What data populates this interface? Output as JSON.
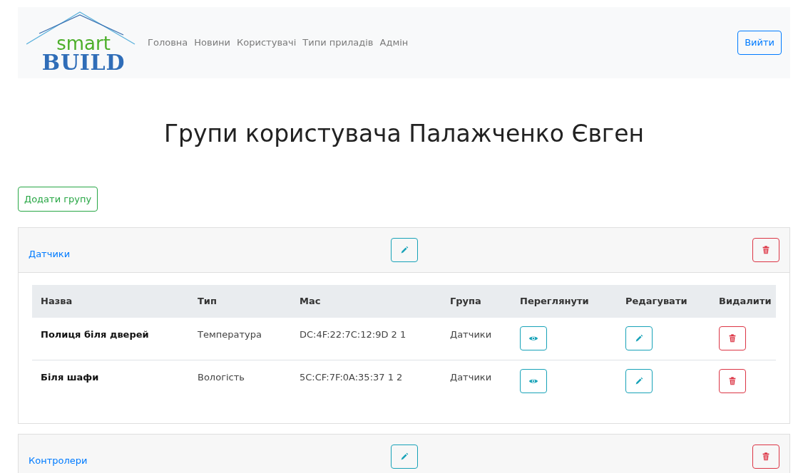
{
  "logo": {
    "top": "smart",
    "bottom": "BUILD"
  },
  "nav": [
    {
      "label": "Головна"
    },
    {
      "label": "Новини"
    },
    {
      "label": "Користувачі"
    },
    {
      "label": "Типи приладів"
    },
    {
      "label": "Адмін"
    }
  ],
  "logout_button": "Вийти",
  "heading": "Групи користувача Палажченко Євген",
  "add_group_button": "Додати групу",
  "groups": [
    {
      "name": "Датчики",
      "table": {
        "columns": [
          "Назва",
          "Тип",
          "Mac",
          "Група",
          "Переглянути",
          "Редагувати",
          "Видалити"
        ],
        "rows": [
          {
            "name": "Полиця біля дверей",
            "type": "Температура",
            "mac": "DC:4F:22:7C:12:9D 2 1",
            "group": "Датчики"
          },
          {
            "name": "Біля шафи",
            "type": "Вологість",
            "mac": "5C:CF:7F:0A:35:37 1 2",
            "group": "Датчики"
          }
        ]
      }
    },
    {
      "name": "Контролери"
    }
  ]
}
